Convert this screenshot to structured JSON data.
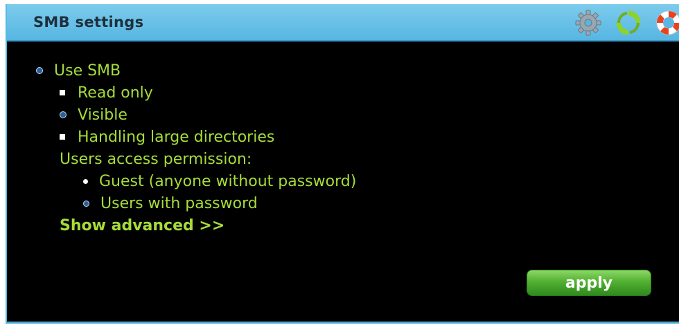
{
  "header": {
    "title": "SMB settings",
    "icons": [
      "gear-icon",
      "refresh-icon",
      "lifebuoy-icon"
    ]
  },
  "form": {
    "use_smb": {
      "label": "Use SMB",
      "checked": true
    },
    "read_only": {
      "label": "Read only",
      "checked": false
    },
    "visible": {
      "label": "Visible",
      "checked": true
    },
    "large_dirs": {
      "label": "Handling large directories",
      "checked": false
    },
    "permissions_label": "Users access permission:",
    "permission_options": [
      {
        "label": "Guest (anyone without password)",
        "selected": false
      },
      {
        "label": "Users with password",
        "selected": true
      }
    ],
    "show_advanced": "Show advanced >>",
    "apply_label": "apply"
  },
  "colors": {
    "title_bar": "#56b6e2",
    "background": "#000000",
    "text": "#a6dc3a",
    "apply_button": "#52b032"
  }
}
